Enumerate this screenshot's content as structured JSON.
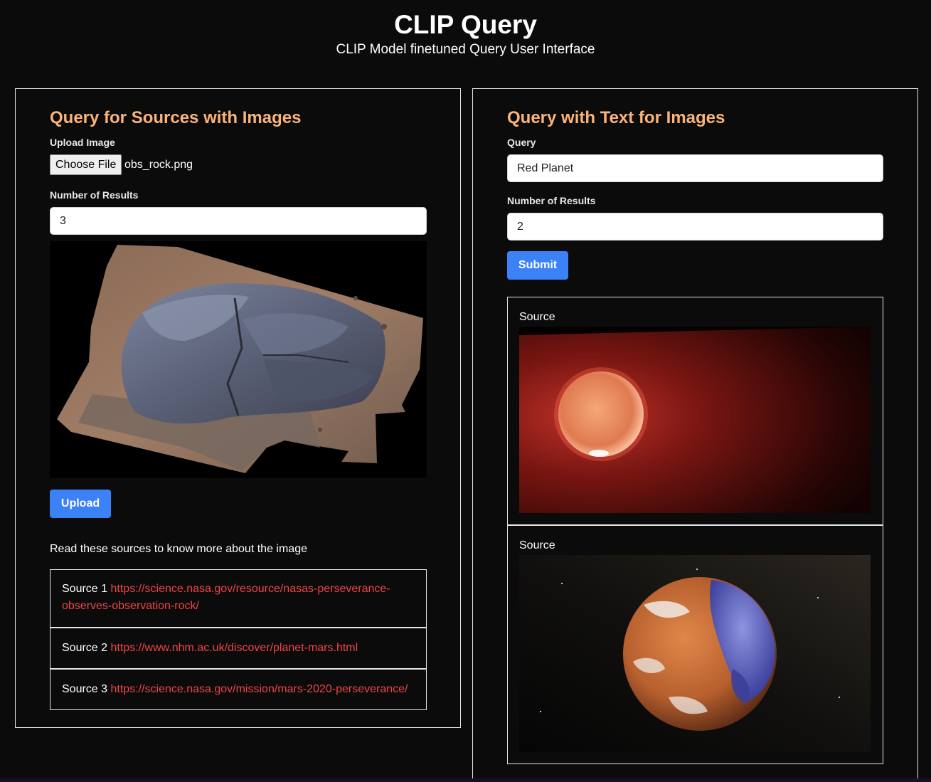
{
  "header": {
    "title": "CLIP Query",
    "subtitle": "CLIP Model finetuned Query User Interface"
  },
  "left_panel": {
    "title": "Query for Sources with Images",
    "upload_label": "Upload Image",
    "choose_file_label": "Choose File",
    "file_name": "obs_rock.png",
    "num_results_label": "Number of Results",
    "num_results_value": "3",
    "upload_button": "Upload",
    "sources_intro": "Read these sources to know more about the image",
    "sources": [
      {
        "label": "Source 1",
        "url": "https://science.nasa.gov/resource/nasas-perseverance-observes-observation-rock/"
      },
      {
        "label": "Source 2",
        "url": "https://www.nhm.ac.uk/discover/planet-mars.html"
      },
      {
        "label": "Source 3",
        "url": "https://science.nasa.gov/mission/mars-2020-perseverance/"
      }
    ]
  },
  "right_panel": {
    "title": "Query with Text for Images",
    "query_label": "Query",
    "query_value": "Red Planet",
    "num_results_label": "Number of Results",
    "num_results_value": "2",
    "submit_button": "Submit",
    "results": [
      {
        "label": "Source"
      },
      {
        "label": "Source"
      }
    ]
  },
  "colors": {
    "accent_title": "#fbb478",
    "button_blue": "#3b82f6",
    "link_red": "#ef4444",
    "background": "#0b0b0b"
  }
}
